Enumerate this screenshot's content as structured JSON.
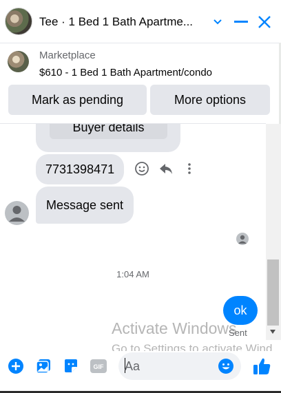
{
  "header": {
    "title": "Tee · 1 Bed 1 Bath Apartme...",
    "icons": [
      "chevron-down-icon",
      "minimize-icon",
      "close-icon"
    ]
  },
  "marketplace": {
    "label": "Marketplace",
    "item": "$610 - 1 Bed 1 Bath Apartment/condo",
    "buttons": {
      "pending": "Mark as pending",
      "more": "More options"
    }
  },
  "chat": {
    "buyer_details": "Buyer details",
    "phone": "7731398471",
    "message_sent": "Message sent",
    "timestamp": "1:04 AM",
    "outgoing": "ok",
    "status": "Sent"
  },
  "watermark": {
    "line1": "Activate Windows",
    "line2": "Go to Settings to activate Wind"
  },
  "composer": {
    "placeholder": "Aa",
    "tools": [
      "add-icon",
      "photo-icon",
      "sticker-icon",
      "gif-icon",
      "emoji-icon",
      "like-icon"
    ]
  },
  "colors": {
    "accent": "#0084ff",
    "bubble": "#e4e6eb",
    "secondary_text": "#65676b"
  }
}
